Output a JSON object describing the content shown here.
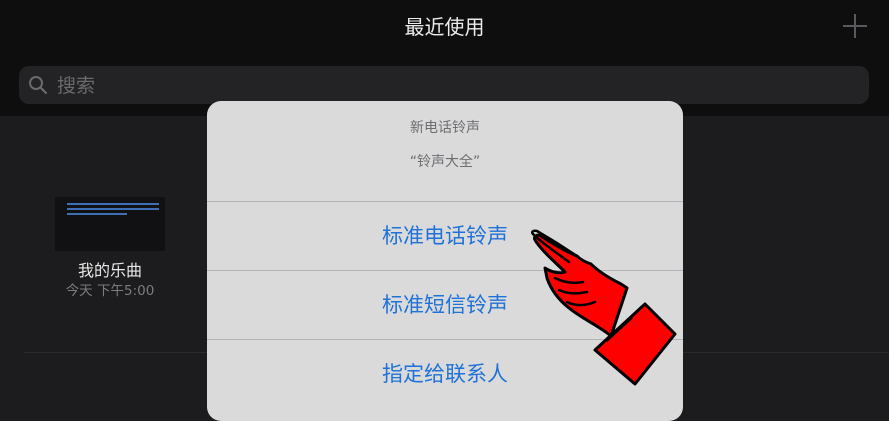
{
  "header": {
    "title": "最近使用",
    "add_icon": "plus-icon"
  },
  "search": {
    "placeholder": "搜索",
    "value": "",
    "icon": "search-icon"
  },
  "songs": [
    {
      "name": "我的乐曲",
      "time": "今天 下午5:00"
    }
  ],
  "action_sheet": {
    "title": "新电话铃声",
    "subtitle": "“铃声大全”",
    "buttons": [
      {
        "label": "标准电话铃声"
      },
      {
        "label": "标准短信铃声"
      },
      {
        "label": "指定给联系人"
      }
    ]
  },
  "colors": {
    "accent": "#1f72d8",
    "sheet_background": "#dadadb",
    "app_background": "#1c1c1e",
    "annotation": "#ff0000"
  },
  "annotation": {
    "icon": "pointing-hand-icon"
  }
}
